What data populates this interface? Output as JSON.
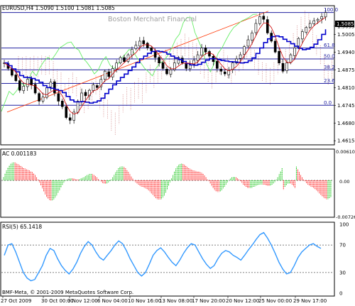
{
  "header": {
    "symbol_line": "EURUSD,H4  1.5090 1.5100 1.5081 1.5085",
    "watermark": "Boston Merchant Financial",
    "current_price_tag": "1.5085"
  },
  "price_axis": {
    "labels": [
      "1.5035",
      "1.5005",
      "1.4940",
      "1.4875",
      "1.4810",
      "1.4745",
      "1.4680",
      "1.4615"
    ],
    "values": [
      1.5035,
      1.5005,
      1.494,
      1.4875,
      1.481,
      1.4745,
      1.468,
      1.4615
    ]
  },
  "fibonacci": {
    "levels": [
      {
        "label": "100.0",
        "price": 1.5085
      },
      {
        "label": "61.8",
        "price": 1.4955
      },
      {
        "label": "50.0",
        "price": 1.4915
      },
      {
        "label": "38.2",
        "price": 1.4875
      },
      {
        "label": "23.6",
        "price": 1.4825
      },
      {
        "label": "0.0",
        "price": 1.4745
      }
    ]
  },
  "ac_panel": {
    "title": "AC 0.001183",
    "axis_labels": [
      "0.006107",
      "0.00",
      "-0.00726"
    ],
    "axis_values": [
      0.006107,
      0,
      -0.00726
    ]
  },
  "rsi_panel": {
    "title": "RSI(5) 65.1418",
    "axis_labels": [
      "100",
      "70",
      "30",
      "0"
    ],
    "axis_values": [
      100,
      70,
      30,
      0
    ]
  },
  "footer": {
    "copyright": "BMF-Meta, © 2001-2009 MetaQuotes Software Corp."
  },
  "time_axis": {
    "labels": [
      "27 Oct 2009",
      "30 Oct 00:00",
      "3 Nov 12:00",
      "6 Nov 04:00",
      "10 Nov 16:00",
      "13 Nov 08:00",
      "17 Nov 20:00",
      "20 Nov 12:00",
      "25 Nov 00:00",
      "29 Nov 17:00"
    ]
  },
  "colors": {
    "bull_bar": "#00c000",
    "bear_bar": "#ff0000",
    "ma_blue": "#0000cc",
    "ma_red": "#cc0000",
    "fib_line": "#2020a0",
    "chikou_green": "#66ee66",
    "cloud_dots": "#d08080",
    "rsi_line": "#3399ff",
    "trendline": "#ff3300"
  },
  "chart_data": [
    {
      "type": "candlestick",
      "title": "EURUSD,H4",
      "ylim": [
        1.46,
        1.511
      ],
      "close_series": [
        1.49,
        1.488,
        1.4855,
        1.4835,
        1.48,
        1.4815,
        1.484,
        1.482,
        1.479,
        1.476,
        1.4775,
        1.481,
        1.483,
        1.479,
        1.476,
        1.474,
        1.47,
        1.469,
        1.472,
        1.476,
        1.479,
        1.478,
        1.48,
        1.482,
        1.481,
        1.484,
        1.487,
        1.485,
        1.488,
        1.49,
        1.492,
        1.4905,
        1.493,
        1.495,
        1.4965,
        1.498,
        1.497,
        1.4955,
        1.4945,
        1.492,
        1.49,
        1.488,
        1.486,
        1.4875,
        1.49,
        1.492,
        1.49,
        1.488,
        1.4895,
        1.491,
        1.493,
        1.4955,
        1.494,
        1.4925,
        1.4905,
        1.488,
        1.487,
        1.486,
        1.4875,
        1.49,
        1.4915,
        1.493,
        1.496,
        1.4985,
        1.501,
        1.5045,
        1.507,
        1.506,
        1.501,
        1.498,
        1.494,
        1.49,
        1.487,
        1.49,
        1.493,
        1.4955,
        1.499,
        1.5015,
        1.503,
        1.5045,
        1.5055,
        1.506,
        1.507,
        1.5085
      ]
    },
    {
      "type": "bar",
      "title": "AC 0.001183",
      "ylim": [
        -0.00726,
        0.006107
      ]
    },
    {
      "type": "line",
      "title": "RSI(5) 65.1418",
      "ylim": [
        0,
        100
      ],
      "values": [
        55,
        70,
        72,
        60,
        45,
        30,
        22,
        18,
        20,
        30,
        40,
        55,
        65,
        62,
        50,
        40,
        33,
        28,
        35,
        45,
        58,
        68,
        75,
        70,
        60,
        52,
        48,
        55,
        62,
        70,
        76,
        72,
        62,
        50,
        40,
        30,
        25,
        30,
        42,
        55,
        62,
        66,
        60,
        52,
        45,
        40,
        48,
        58,
        66,
        72,
        70,
        60,
        50,
        42,
        36,
        40,
        50,
        58,
        62,
        60,
        55,
        52,
        48,
        55,
        63,
        70,
        78,
        85,
        88,
        80,
        70,
        58,
        45,
        35,
        28,
        30,
        40,
        52,
        60,
        65,
        70,
        72,
        68,
        65
      ]
    }
  ]
}
